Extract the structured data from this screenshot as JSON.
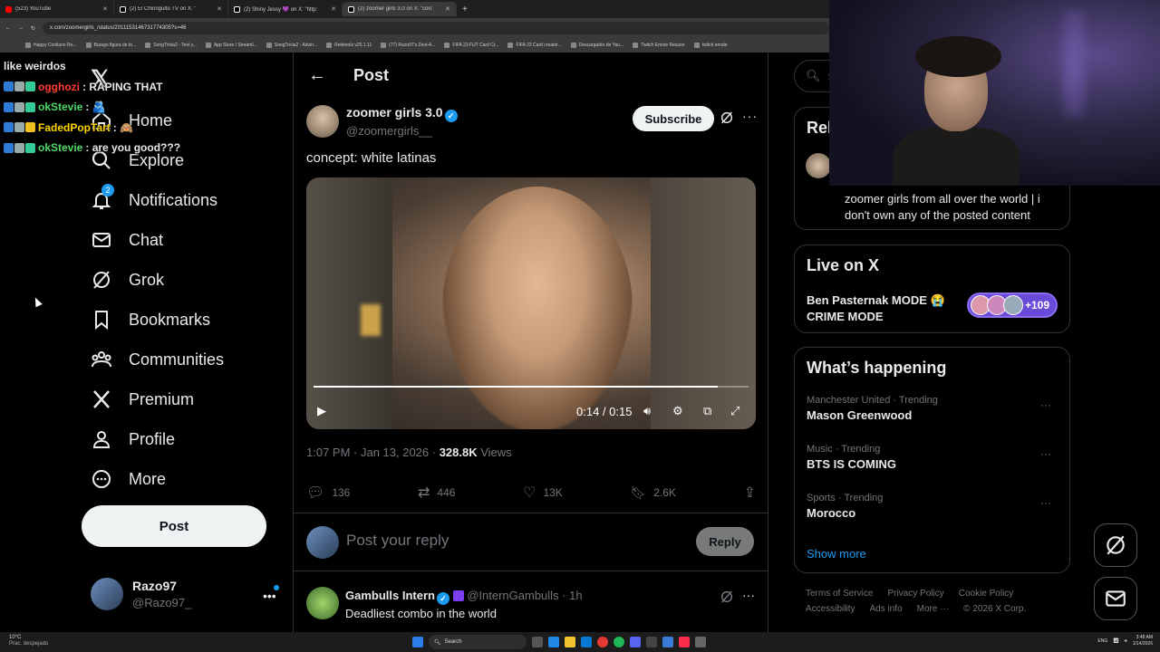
{
  "browser": {
    "tabs": [
      {
        "label": "(523) YouTube",
        "color": "#ff0000"
      },
      {
        "label": "(2) El Chiringuito TV on X: \"",
        "color": "#000000"
      },
      {
        "label": "(2) Shiny Jessy 💜 on X: \"http:",
        "color": "#000000"
      },
      {
        "label": "(2) zoomer girls 3.0 on X: \"con:",
        "color": "#000000"
      }
    ],
    "url": "x.com/zoomergirls_/status/2011153146731774305?s=46",
    "bookmarks": [
      "Happy Cristiano Ro...",
      "Burago figura de to...",
      "SongTrivia2 - Test y...",
      "App Store / Streaml...",
      "SongTrivia2 - Advin...",
      "Reletools v25.1.11",
      "(77) Razo97's Zest-A...",
      "FIFA 23 FUT Card Cr...",
      "FIFA 23 Card creator...",
      "Descargador de You...",
      "Twitch Emote Resizer",
      "twitch emote"
    ]
  },
  "chat": {
    "header": "like weirdos",
    "messages": [
      {
        "user": "ogghozi",
        "text": ": RAPING THAT",
        "color": "#ff3b30"
      },
      {
        "user": "okStevie",
        "text": ": 🫂",
        "color": "#4cd964"
      },
      {
        "user": "FadedPopTart",
        "text": ": 🙈",
        "color": "#ffd400"
      },
      {
        "user": "okStevie",
        "text": ": are you good???",
        "color": "#4cd964"
      }
    ]
  },
  "sidebar": {
    "items": [
      {
        "label": "Home",
        "icon": "home-icon"
      },
      {
        "label": "Explore",
        "icon": "search-icon"
      },
      {
        "label": "Notifications",
        "icon": "bell-icon",
        "badge": "2"
      },
      {
        "label": "Chat",
        "icon": "mail-icon"
      },
      {
        "label": "Grok",
        "icon": "grok-icon"
      },
      {
        "label": "Bookmarks",
        "icon": "bookmark-icon"
      },
      {
        "label": "Communities",
        "icon": "communities-icon"
      },
      {
        "label": "Premium",
        "icon": "x-logo-icon"
      },
      {
        "label": "Profile",
        "icon": "profile-icon"
      },
      {
        "label": "More",
        "icon": "more-circle-icon"
      }
    ],
    "post_label": "Post",
    "me": {
      "name": "Razo97",
      "handle": "@Razo97_"
    }
  },
  "main": {
    "header_title": "Post",
    "author": {
      "name": "zoomer girls 3.0",
      "handle": "@zoomergirls__"
    },
    "subscribe_label": "Subscribe",
    "post_text": "concept: white latinas",
    "video": {
      "time": "0:14 / 0:15",
      "progress": 0.93
    },
    "meta": {
      "time": "1:07 PM · Jan 13, 2026 · ",
      "views": "328.8K",
      "views_label": " Views"
    },
    "actions": {
      "replies": "136",
      "reposts": "446",
      "likes": "13K",
      "bookmarks": "2.6K"
    },
    "reply_placeholder": "Post your reply",
    "reply_label": "Reply",
    "comment": {
      "name": "Gambulls Intern",
      "handle": "@InternGambulls · 1h",
      "text": "Deadliest combo in the world"
    }
  },
  "right": {
    "search_placeholder": "Se",
    "relevant": {
      "title": "Rel",
      "bio": "zoomer girls from all over the world | i don't own any of the posted content"
    },
    "live": {
      "title": "Live on X",
      "text1": "Ben Pasternak MODE 😭",
      "text2": "CRIME MODE",
      "count": "+109"
    },
    "happening": {
      "title": "What’s happening",
      "trends": [
        {
          "context": "Manchester United · Trending",
          "name": "Mason Greenwood"
        },
        {
          "context": "Music · Trending",
          "name": "BTS IS COMING"
        },
        {
          "context": "Sports · Trending",
          "name": "Morocco"
        }
      ],
      "show_more": "Show more"
    },
    "footer": [
      "Terms of Service",
      "Privacy Policy",
      "Cookie Policy",
      "Accessibility",
      "Ads info",
      "More ···",
      "© 2026 X Corp."
    ]
  },
  "taskbar": {
    "weather_temp": "10°C",
    "weather_desc": "Prac. despejado",
    "search": "Search",
    "lang": "ENG",
    "time": "3:48 AM",
    "date": "1/14/2026"
  }
}
